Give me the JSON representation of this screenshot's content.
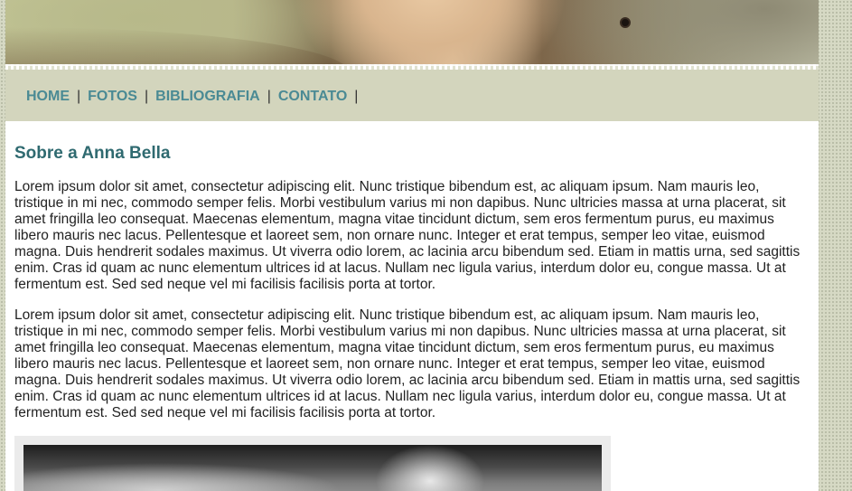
{
  "nav": {
    "items": [
      {
        "label": "HOME"
      },
      {
        "label": "FOTOS"
      },
      {
        "label": "BIBLIOGRAFIA"
      },
      {
        "label": "CONTATO"
      }
    ],
    "separator": "|"
  },
  "main": {
    "title": "Sobre a Anna Bella",
    "paragraphs": [
      "Lorem ipsum dolor sit amet, consectetur adipiscing elit. Nunc tristique bibendum est, ac aliquam ipsum. Nam mauris leo, tristique in mi nec, commodo semper felis. Morbi vestibulum varius mi non dapibus. Nunc ultricies massa at urna placerat, sit amet fringilla leo consequat. Maecenas elementum, magna vitae tincidunt dictum, sem eros fermentum purus, eu maximus libero mauris nec lacus. Pellentesque et laoreet sem, non ornare nunc. Integer et erat tempus, semper leo vitae, euismod magna. Duis hendrerit sodales maximus. Ut viverra odio lorem, ac lacinia arcu bibendum sed. Etiam in mattis urna, sed sagittis enim. Cras id quam ac nunc elementum ultrices id at lacus. Nullam nec ligula varius, interdum dolor eu, congue massa. Ut at fermentum est. Sed sed neque vel mi facilisis facilisis porta at tortor.",
      "Lorem ipsum dolor sit amet, consectetur adipiscing elit. Nunc tristique bibendum est, ac aliquam ipsum. Nam mauris leo, tristique in mi nec, commodo semper felis. Morbi vestibulum varius mi non dapibus. Nunc ultricies massa at urna placerat, sit amet fringilla leo consequat. Maecenas elementum, magna vitae tincidunt dictum, sem eros fermentum purus, eu maximus libero mauris nec lacus. Pellentesque et laoreet sem, non ornare nunc. Integer et erat tempus, semper leo vitae, euismod magna. Duis hendrerit sodales maximus. Ut viverra odio lorem, ac lacinia arcu bibendum sed. Etiam in mattis urna, sed sagittis enim. Cras id quam ac nunc elementum ultrices id at lacus. Nullam nec ligula varius, interdum dolor eu, congue massa. Ut at fermentum est. Sed sed neque vel mi facilisis facilisis porta at tortor."
    ]
  },
  "colors": {
    "nav_link": "#4a8a94",
    "heading": "#2f6a70",
    "navbar_bg": "#d3d5bd",
    "side_bg": "#d6d9c4"
  }
}
